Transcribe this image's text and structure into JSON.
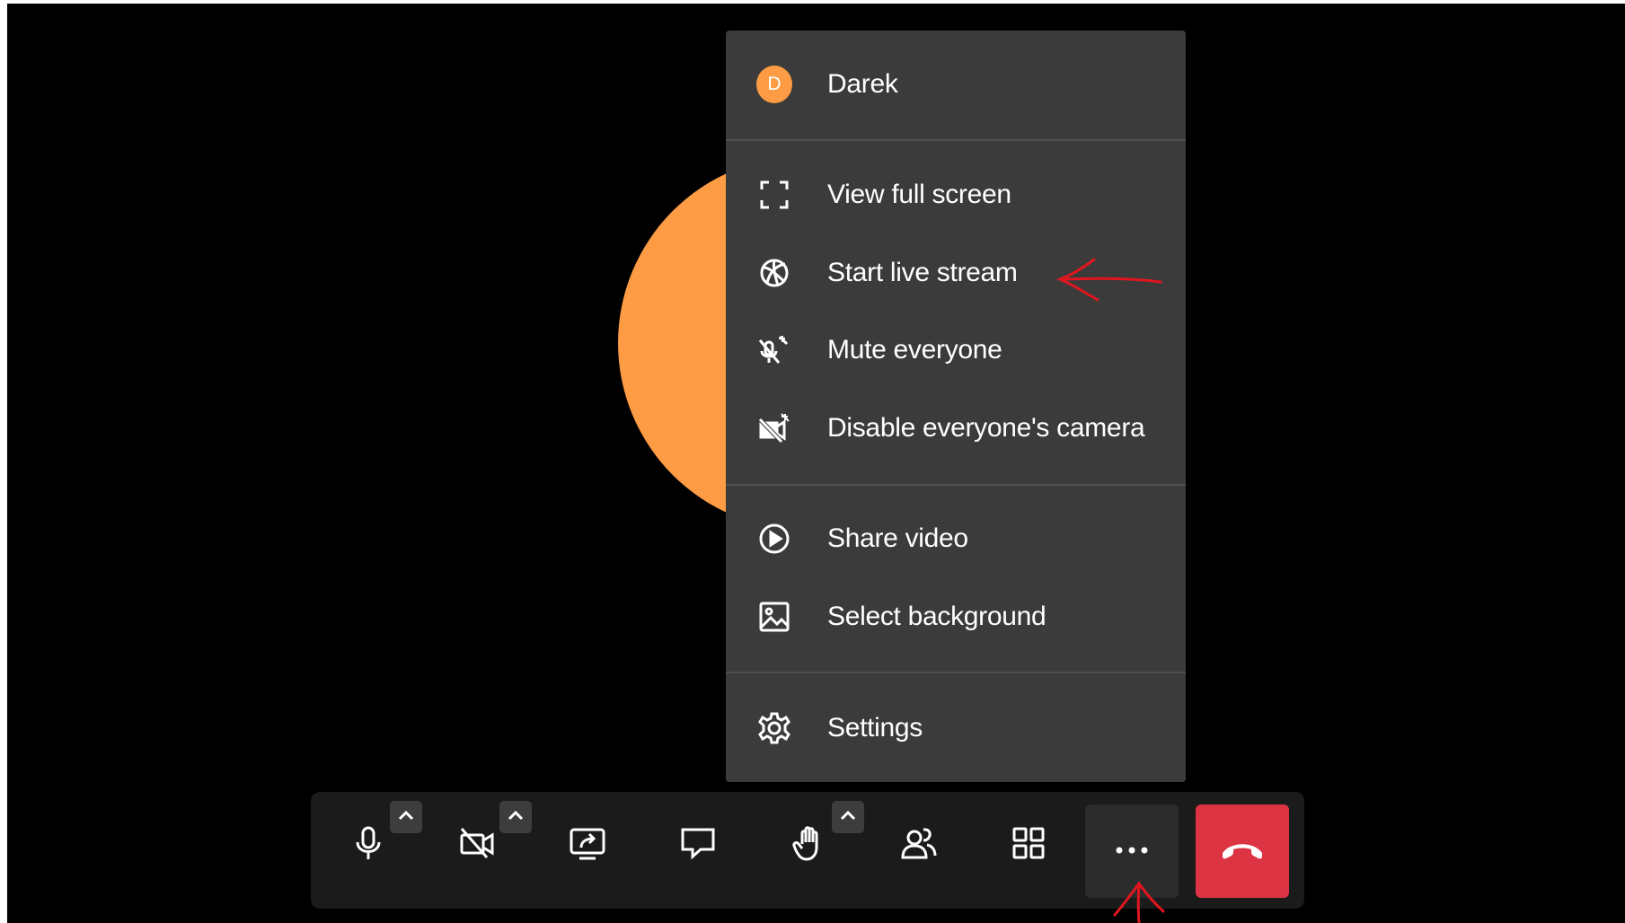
{
  "menu": {
    "user": {
      "initial": "D",
      "name": "Darek"
    },
    "items": [
      {
        "id": "fullscreen",
        "label": "View full screen",
        "icon": "fullscreen-icon"
      },
      {
        "id": "livestream",
        "label": "Start live stream",
        "icon": "live-stream-icon"
      },
      {
        "id": "mute-all",
        "label": "Mute everyone",
        "icon": "mute-everyone-icon"
      },
      {
        "id": "disable-cams",
        "label": "Disable everyone's camera",
        "icon": "disable-camera-icon"
      },
      {
        "id": "share-video",
        "label": "Share video",
        "icon": "play-circle-icon"
      },
      {
        "id": "background",
        "label": "Select background",
        "icon": "image-icon"
      },
      {
        "id": "settings",
        "label": "Settings",
        "icon": "gear-icon"
      }
    ]
  },
  "toolbar": {
    "buttons": [
      "microphone-icon",
      "camera-off-icon",
      "share-screen-icon",
      "chat-icon",
      "raise-hand-icon",
      "participants-icon",
      "tile-view-icon",
      "more-options-icon",
      "hang-up-icon"
    ]
  },
  "colors": {
    "stage_bg": "#000000",
    "avatar_orange": "#fd9c44",
    "menu_bg": "#3b3b3b",
    "toolbar_bg": "#1b1b1b",
    "hangup_red": "#dd3444",
    "annotation_red": "#e0161f"
  }
}
